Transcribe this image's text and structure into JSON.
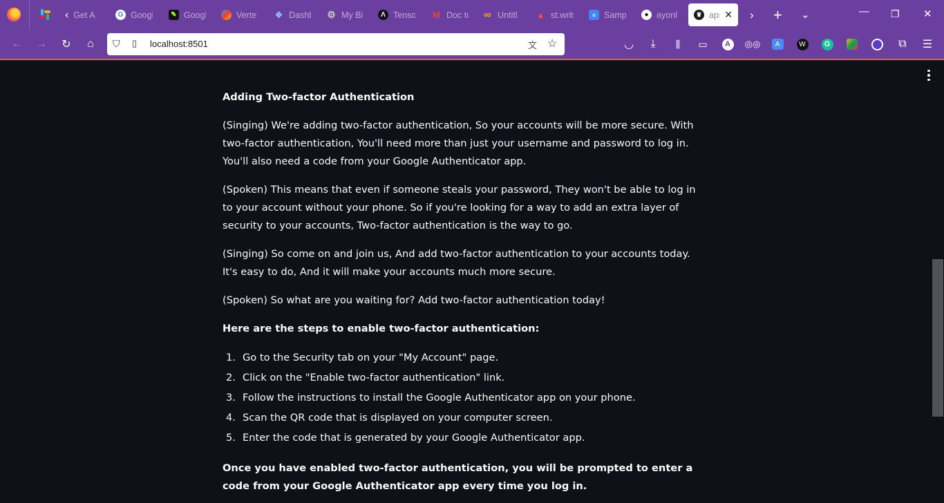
{
  "browser": {
    "tabs": [
      {
        "label": "Get Al",
        "favicon": "chevron-left-icon"
      },
      {
        "label": "Googl",
        "favicon": "google-icon"
      },
      {
        "label": "Googl",
        "favicon": "google-colab-icon"
      },
      {
        "label": "Verte",
        "favicon": "vertex-ai-icon"
      },
      {
        "label": "Dashb",
        "favicon": "dashboard-icon"
      },
      {
        "label": "My Bi",
        "favicon": "gear-icon"
      },
      {
        "label": "Tenso",
        "favicon": "tensorflow-icon"
      },
      {
        "label": "Doc tc",
        "favicon": "gmail-icon"
      },
      {
        "label": "Untitl",
        "favicon": "infinity-icon"
      },
      {
        "label": "st.writ",
        "favicon": "streamlit-icon"
      },
      {
        "label": "Samp",
        "favicon": "docs-icon"
      },
      {
        "label": "ayonl",
        "favicon": "github-icon"
      },
      {
        "label": "app",
        "favicon": "streamlit-crown-icon"
      }
    ],
    "url": "localhost:8501",
    "accent_color": "#f25c3a",
    "chrome_color": "#6b3fa0"
  },
  "page": {
    "heading": "Adding Two-factor Authentication",
    "paragraphs": [
      "(Singing) We're adding two-factor authentication, So your accounts will be more secure. With two-factor authentication, You'll need more than just your username and password to log in. You'll also need a code from your Google Authenticator app.",
      "(Spoken) This means that even if someone steals your password, They won't be able to log in to your account without your phone. So if you're looking for a way to add an extra layer of security to your accounts, Two-factor authentication is the way to go.",
      "(Singing) So come on and join us, And add two-factor authentication to your accounts today. It's easy to do, And it will make your accounts much more secure.",
      "(Spoken) So what are you waiting for? Add two-factor authentication today!"
    ],
    "steps_heading": "Here are the steps to enable two-factor authentication:",
    "steps": [
      {
        "num": "1.",
        "text": "Go to the Security tab on your \"My Account\" page."
      },
      {
        "num": "2.",
        "text": "Click on the \"Enable two-factor authentication\" link."
      },
      {
        "num": "3.",
        "text": "Follow the instructions to install the Google Authenticator app on your phone."
      },
      {
        "num": "4.",
        "text": "Scan the QR code that is displayed on your computer screen."
      },
      {
        "num": "5.",
        "text": "Enter the code that is generated by your Google Authenticator app."
      }
    ],
    "closing": "Once you have enabled two-factor authentication, you will be prompted to enter a code from your Google Authenticator app every time you log in."
  }
}
